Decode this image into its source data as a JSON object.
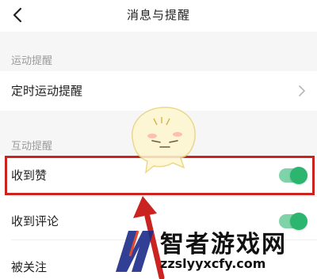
{
  "header": {
    "title": "消息与提醒"
  },
  "sections": {
    "sport": {
      "label": "运动提醒",
      "items": [
        {
          "label": "定时运动提醒"
        }
      ]
    },
    "interaction": {
      "label": "互动提醒",
      "items": [
        {
          "label": "收到赞",
          "on": true
        },
        {
          "label": "收到评论",
          "on": true
        },
        {
          "label": "被关注"
        }
      ]
    }
  },
  "watermark": {
    "logo_text": "智者游戏网",
    "url": "zzslyyxcfy.com"
  },
  "colors": {
    "toggle_track": "#7fd3a8",
    "toggle_knob": "#2cb56f",
    "highlight": "#c9241f"
  }
}
